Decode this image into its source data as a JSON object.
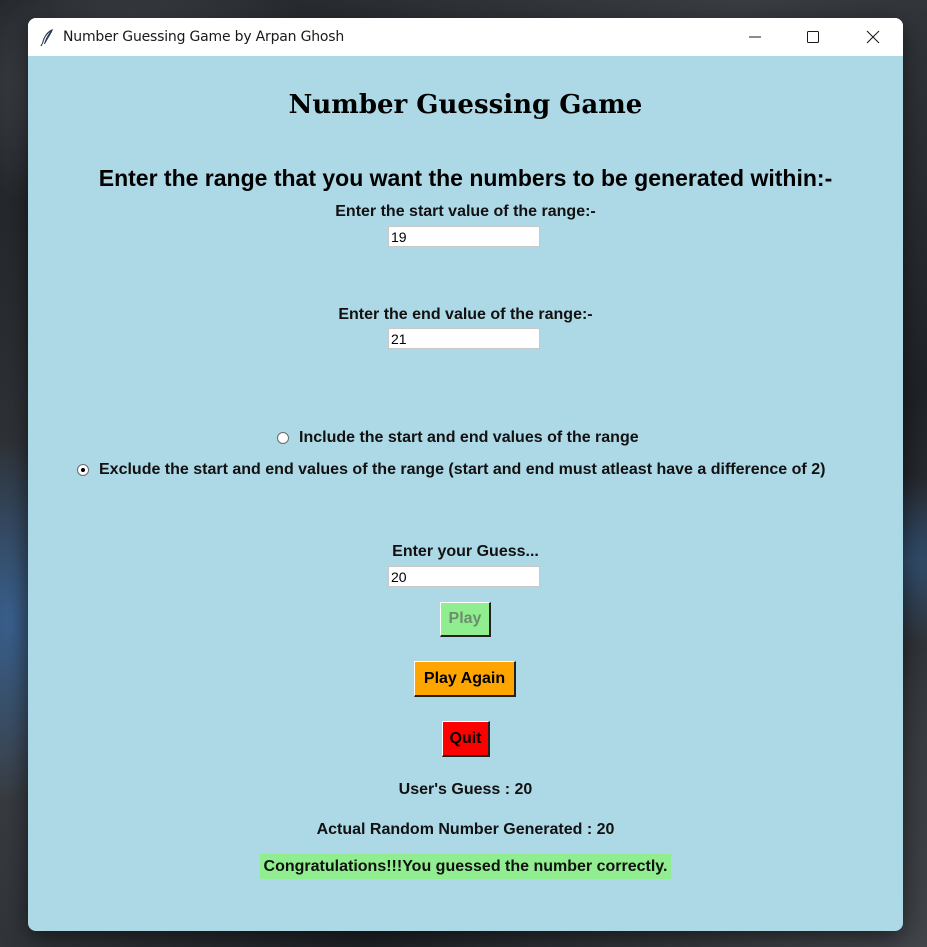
{
  "window": {
    "title": "Number Guessing Game by Arpan Ghosh",
    "background": "#add8e6",
    "icon": "feather-icon",
    "controls": [
      "minimize-icon",
      "maximize-icon",
      "close-icon"
    ]
  },
  "game": {
    "heading": "Number Guessing Game",
    "subheading": "Enter the range that you want the numbers to be generated within:-",
    "start_label": "Enter the start value of the range:-",
    "start_value": "19",
    "end_label": "Enter the end value of the range:-",
    "end_value": "21",
    "range_options": [
      {
        "label": "Include the start and end values of the range",
        "selected": false
      },
      {
        "label": "Exclude the start and end values of the range (start and end must atleast have a difference of 2)",
        "selected": true
      }
    ],
    "guess_label": "Enter your Guess...",
    "guess_value": "20",
    "buttons": {
      "play": "Play",
      "play_again": "Play Again",
      "quit": "Quit"
    },
    "button_colors": {
      "play": "#90ee90",
      "play_again": "#ffa500",
      "quit": "#ff0000"
    },
    "user_guess_text": "User's Guess : 20",
    "actual_number_text": "Actual Random Number Generated : 20",
    "result_message": "Congratulations!!!You guessed the number correctly.",
    "result_color": "#90ee90"
  }
}
